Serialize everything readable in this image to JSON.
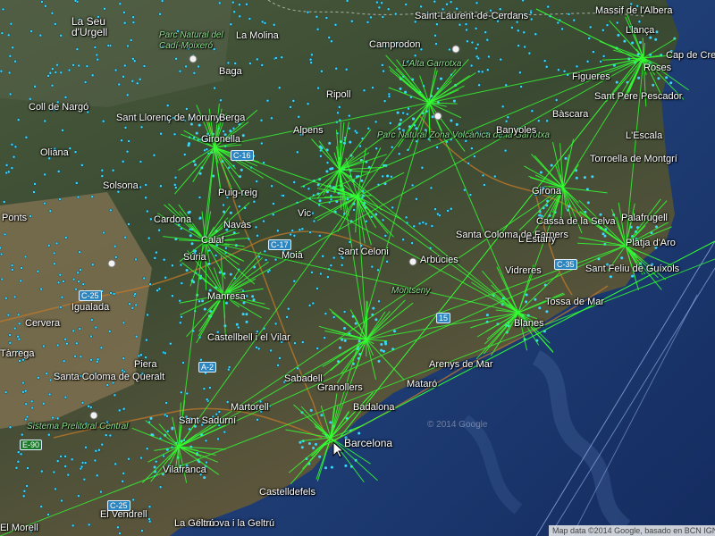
{
  "map": {
    "labels": [
      {
        "text": "La Seu d'Urgell",
        "lines": [
          "La Seu",
          "d'Urgell"
        ]
      },
      {
        "text": "Parc Natural del Cadí-Moixeró",
        "lines": [
          "Parc Natural del",
          "Cadí-Moixeró"
        ]
      },
      {
        "text": "La Molina"
      },
      {
        "text": "Camprodon"
      },
      {
        "text": "Saint-Laurent-de-Cerdans"
      },
      {
        "text": "Massif de l'Albera"
      },
      {
        "text": "L'Alta Garrotxa"
      },
      {
        "text": "Llança"
      },
      {
        "text": "Cap de Creus"
      },
      {
        "text": "Roses"
      },
      {
        "text": "Baga"
      },
      {
        "text": "Ripoll"
      },
      {
        "text": "Figueres"
      },
      {
        "text": "Sant Pere Pescador"
      },
      {
        "text": "Coll de Nargó"
      },
      {
        "text": "Sant Llorenç de Morunys"
      },
      {
        "text": "Berga"
      },
      {
        "text": "Alpens"
      },
      {
        "text": "Parc Natural Zona Volcànica de la Garrotxa"
      },
      {
        "text": "Banyoles"
      },
      {
        "text": "Bàscara"
      },
      {
        "text": "L'Escala"
      },
      {
        "text": "Oliana"
      },
      {
        "text": "Gironella"
      },
      {
        "text": "Torroella de Montgrí"
      },
      {
        "text": "Solsona"
      },
      {
        "text": "Puig-reig"
      },
      {
        "text": "Girona"
      },
      {
        "text": "Vic"
      },
      {
        "text": "Palafrugell"
      },
      {
        "text": "Cardona"
      },
      {
        "text": "Navàs"
      },
      {
        "text": "Santa Coloma de Farners"
      },
      {
        "text": "Cassà de la Selva"
      },
      {
        "text": "Ponts"
      },
      {
        "text": "Calaf"
      },
      {
        "text": "L'Estany"
      },
      {
        "text": "Platja d'Aro"
      },
      {
        "text": "Súria"
      },
      {
        "text": "Moià"
      },
      {
        "text": "Arbúcies"
      },
      {
        "text": "Sant Feliu de Guíxols"
      },
      {
        "text": "Manresa"
      },
      {
        "text": "Sant Celoni"
      },
      {
        "text": "Vidreres"
      },
      {
        "text": "Tossa de Mar"
      },
      {
        "text": "Cervera"
      },
      {
        "text": "Montseny"
      },
      {
        "text": "Igualada"
      },
      {
        "text": "Castellbell i el Vilar"
      },
      {
        "text": "Blanes"
      },
      {
        "text": "Santa Coloma de Queralt"
      },
      {
        "text": "Piera"
      },
      {
        "text": "Arenys de Mar"
      },
      {
        "text": "Mataró"
      },
      {
        "text": "Sabadell"
      },
      {
        "text": "Granollers"
      },
      {
        "text": "Martorell"
      },
      {
        "text": "Sant Sadurní"
      },
      {
        "text": "Badalona"
      },
      {
        "text": "Sistema Prelitoral Central"
      },
      {
        "text": "Barcelona"
      },
      {
        "text": "Vilafranca"
      },
      {
        "text": "Vilanova i la Geltrú"
      },
      {
        "text": "Castelldefels"
      },
      {
        "text": "El Vendrell"
      },
      {
        "text": "La Geltrú"
      },
      {
        "text": "Tàrrega"
      },
      {
        "text": "El Morell"
      }
    ],
    "roads": [
      "C-16",
      "C-25",
      "C-35",
      "C-25",
      "E-90",
      "A-2",
      "15",
      "C-17"
    ],
    "watermark": "© 2014 Google",
    "attribution": "Map data ©2014 Google, basado en BCN IGN España",
    "colors": {
      "land": "#34482f",
      "sea": "#1f3f78",
      "network": "#33ff33",
      "stations": "#3ad8ff"
    }
  }
}
